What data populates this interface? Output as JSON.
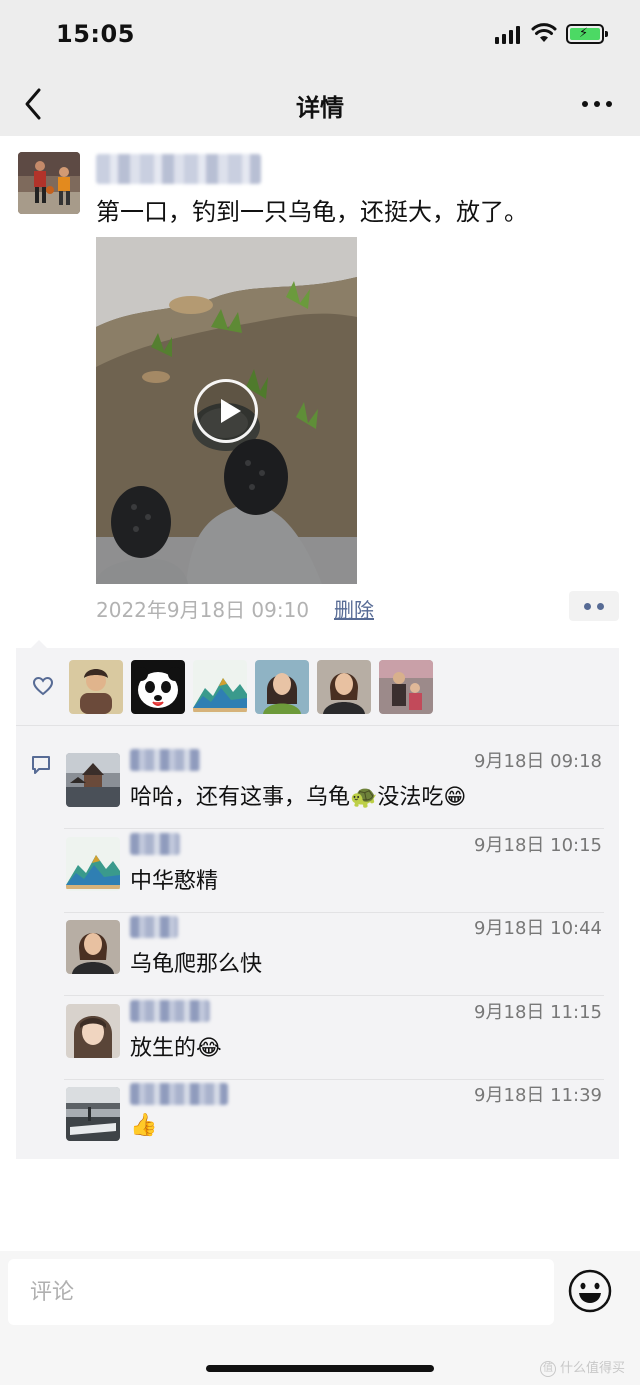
{
  "status_bar": {
    "time": "15:05"
  },
  "nav": {
    "title": "详情"
  },
  "post": {
    "text": "第一口，钓到一只乌龟，还挺大，放了。",
    "timestamp": "2022年9月18日 09:10",
    "delete_label": "删除"
  },
  "comments": [
    {
      "time": "9月18日 09:18",
      "text": "哈哈，还有这事，乌龟🐢没法吃😁"
    },
    {
      "time": "9月18日 10:15",
      "text": "中华憨精"
    },
    {
      "time": "9月18日 10:44",
      "text": "乌龟爬那么快"
    },
    {
      "time": "9月18日 11:15",
      "text": "放生的😂"
    },
    {
      "time": "9月18日 11:39",
      "text": "👍"
    }
  ],
  "input": {
    "placeholder": "评论"
  },
  "watermark": {
    "text": "什么值得买",
    "logo": "值"
  },
  "colors": {
    "link": "#576b95",
    "nav_bg": "#ededed",
    "panel_bg": "#f3f3f5"
  }
}
